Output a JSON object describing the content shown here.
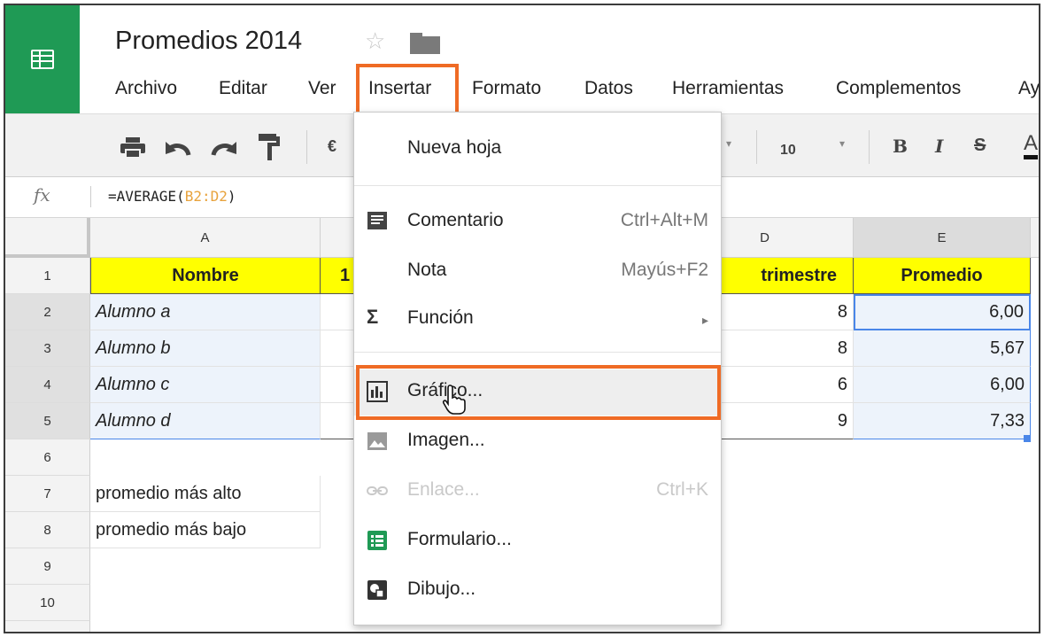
{
  "doc": {
    "title": "Promedios 2014"
  },
  "menubar": [
    "Archivo",
    "Editar",
    "Ver",
    "Insertar",
    "Formato",
    "Datos",
    "Herramientas",
    "Complementos",
    "Ay"
  ],
  "toolbar": {
    "currency": "€",
    "font_size": "10",
    "bold": "B",
    "italic": "I",
    "strike": "S",
    "text_color": "A"
  },
  "formula_bar": {
    "fx": "fx",
    "prefix": "=AVERAGE(",
    "ref": "B2:D2",
    "suffix": ")"
  },
  "columns": [
    "A",
    "D",
    "E"
  ],
  "rows": [
    "1",
    "2",
    "3",
    "4",
    "5",
    "6",
    "7",
    "8",
    "9",
    "10"
  ],
  "sheet": {
    "header": {
      "name": "Nombre",
      "b_partial": "1",
      "d": "trimestre",
      "e": "Promedio"
    },
    "students": [
      {
        "name": "Alumno a",
        "d": "8",
        "avg": "6,00"
      },
      {
        "name": "Alumno b",
        "d": "8",
        "avg": "5,67"
      },
      {
        "name": "Alumno c",
        "d": "6",
        "avg": "6,00"
      },
      {
        "name": "Alumno d",
        "d": "9",
        "avg": "7,33"
      }
    ],
    "row7": "promedio más alto",
    "row8": "promedio más bajo"
  },
  "insert_menu": {
    "items": [
      {
        "label": "Nueva hoja",
        "shortcut": ""
      },
      {
        "label": "Comentario",
        "shortcut": "Ctrl+Alt+M"
      },
      {
        "label": "Nota",
        "shortcut": "Mayús+F2"
      },
      {
        "label": "Función",
        "shortcut": "▸"
      },
      {
        "label": "Gráfico...",
        "shortcut": ""
      },
      {
        "label": "Imagen...",
        "shortcut": ""
      },
      {
        "label": "Enlace...",
        "shortcut": "Ctrl+K"
      },
      {
        "label": "Formulario...",
        "shortcut": ""
      },
      {
        "label": "Dibujo...",
        "shortcut": ""
      }
    ]
  },
  "colors": {
    "brand": "#1f9a55",
    "highlight": "#ef6b25",
    "header_fill": "#ffff00",
    "selection": "#4a86e8"
  }
}
